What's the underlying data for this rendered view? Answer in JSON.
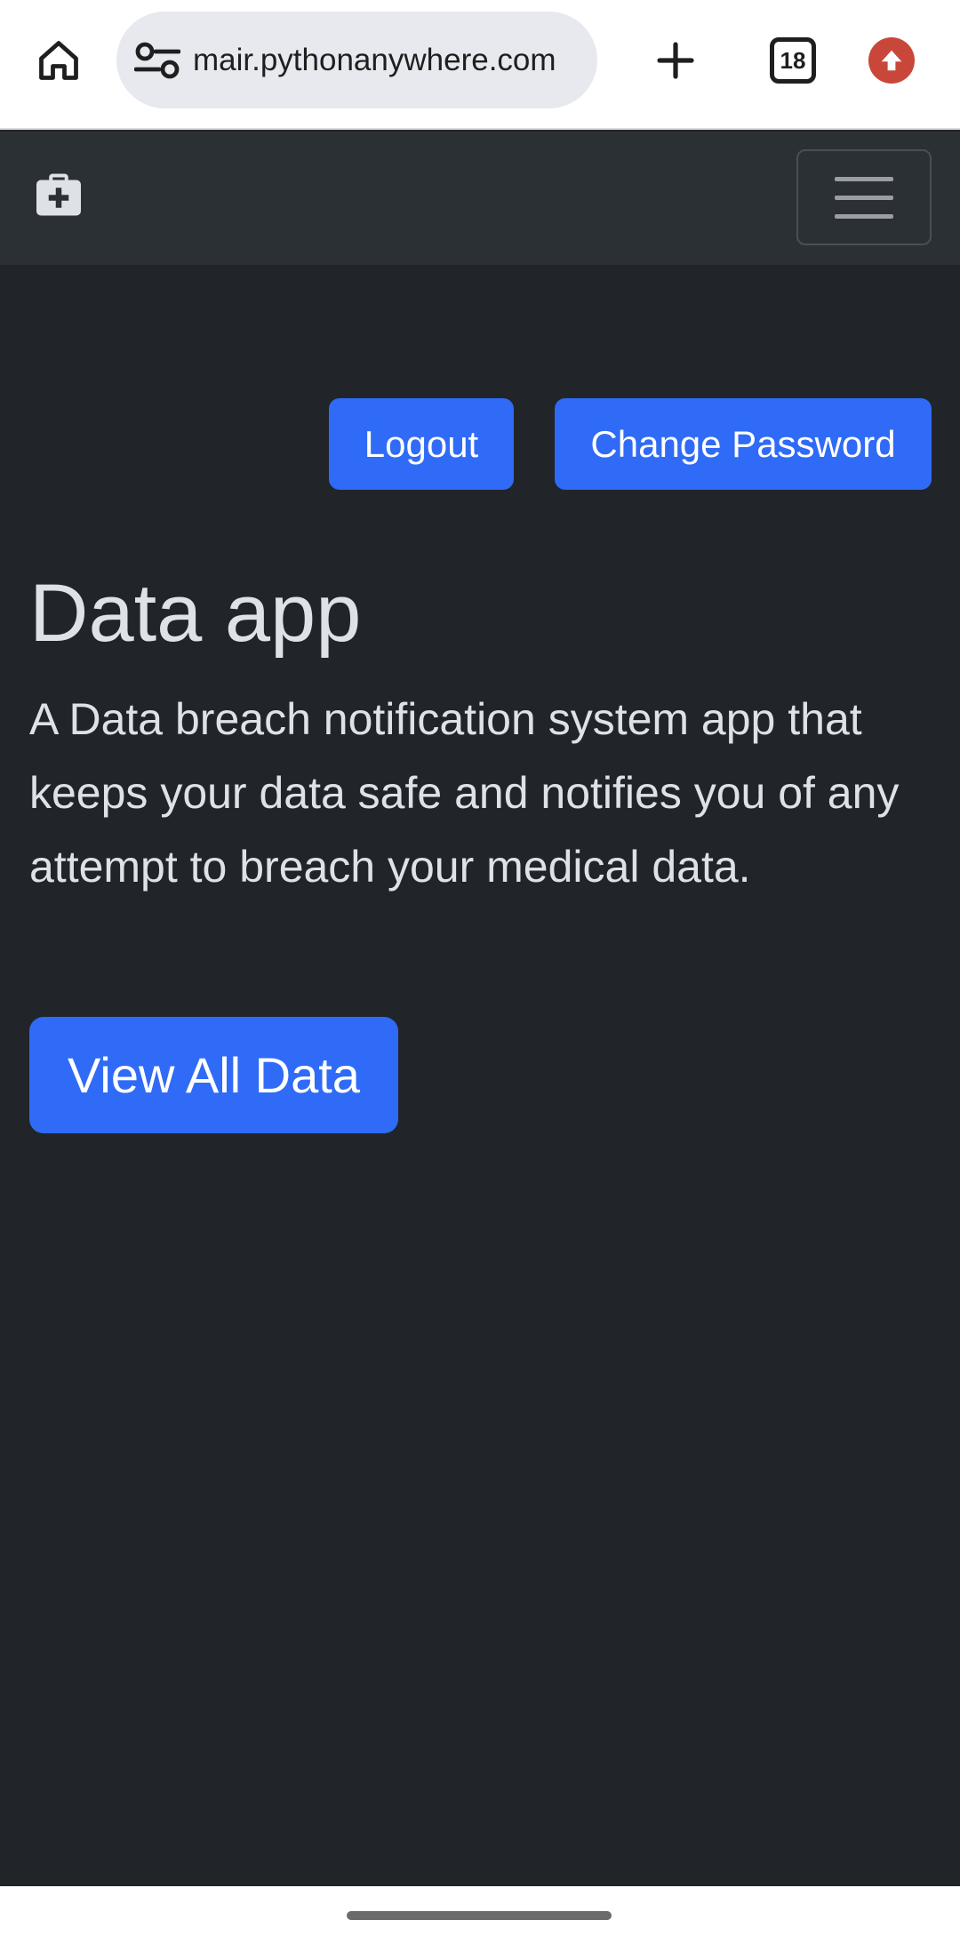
{
  "browser": {
    "url": "mair.pythonanywhere.com",
    "tab_count": "18"
  },
  "navbar": {
    "brand_icon": "medkit-icon",
    "toggler_icon": "hamburger-icon"
  },
  "actions": {
    "logout_label": "Logout",
    "change_password_label": "Change Password"
  },
  "main": {
    "title": "Data app",
    "lead": "A Data breach notification system app that keeps your data safe and notifies you of any attempt to breach your medical data.",
    "view_all_label": "View All Data"
  },
  "colors": {
    "primary": "#2f6bf6",
    "page_bg": "#212529",
    "navbar_bg": "#2b3035",
    "text": "#dee2e6",
    "update_badge": "#c9473a"
  }
}
